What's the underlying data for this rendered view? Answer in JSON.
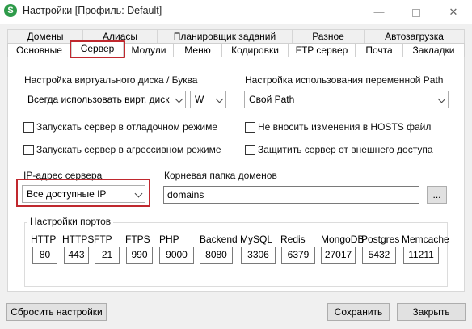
{
  "window": {
    "app_icon_letter": "S",
    "title": "Настройки [Профиль: Default]",
    "minimize": "—",
    "close": "✕"
  },
  "tabs_row1": [
    "Домены",
    "Алиасы",
    "Планировщик заданий",
    "Разное",
    "Автозагрузка"
  ],
  "tabs_row2": [
    "Основные",
    "Сервер",
    "Модули",
    "Меню",
    "Кодировки",
    "FTP сервер",
    "Почта",
    "Закладки"
  ],
  "active_tab": "Сервер",
  "virtual_disk": {
    "label": "Настройка виртуального диска / Буква",
    "mode": "Всегда использовать вирт. диск",
    "letter": "W"
  },
  "path_setting": {
    "label": "Настройка использования переменной Path",
    "value": "Свой Path"
  },
  "checkboxes": {
    "debug_mode": {
      "label": "Запускать сервер в отладочном режиме",
      "checked": false
    },
    "aggressive_mode": {
      "label": "Запускать сервер в агрессивном режиме",
      "checked": false
    },
    "no_hosts": {
      "label": "Не вносить изменения в HOSTS файл",
      "checked": false
    },
    "protect_external": {
      "label": "Защитить сервер от внешнего доступа",
      "checked": false
    }
  },
  "ip_address": {
    "label": "IP-адрес сервера",
    "value": "Все доступные IP"
  },
  "domains_root": {
    "label": "Корневая папка доменов",
    "value": "domains",
    "browse": "..."
  },
  "ports": {
    "legend": "Настройки портов",
    "items": [
      {
        "name": "HTTP",
        "value": "80"
      },
      {
        "name": "HTTPS",
        "value": "443"
      },
      {
        "name": "FTP",
        "value": "21"
      },
      {
        "name": "FTPS",
        "value": "990"
      },
      {
        "name": "PHP",
        "value": "9000"
      },
      {
        "name": "Backend",
        "value": "8080"
      },
      {
        "name": "MySQL",
        "value": "3306"
      },
      {
        "name": "Redis",
        "value": "6379"
      },
      {
        "name": "MongoDB",
        "value": "27017"
      },
      {
        "name": "Postgres",
        "value": "5432"
      },
      {
        "name": "Memcache",
        "value": "11211"
      }
    ]
  },
  "buttons": {
    "reset": "Сбросить настройки",
    "save": "Сохранить",
    "close": "Закрыть"
  },
  "colors": {
    "highlight": "#c0282e",
    "app_icon": "#2e9b4a"
  }
}
